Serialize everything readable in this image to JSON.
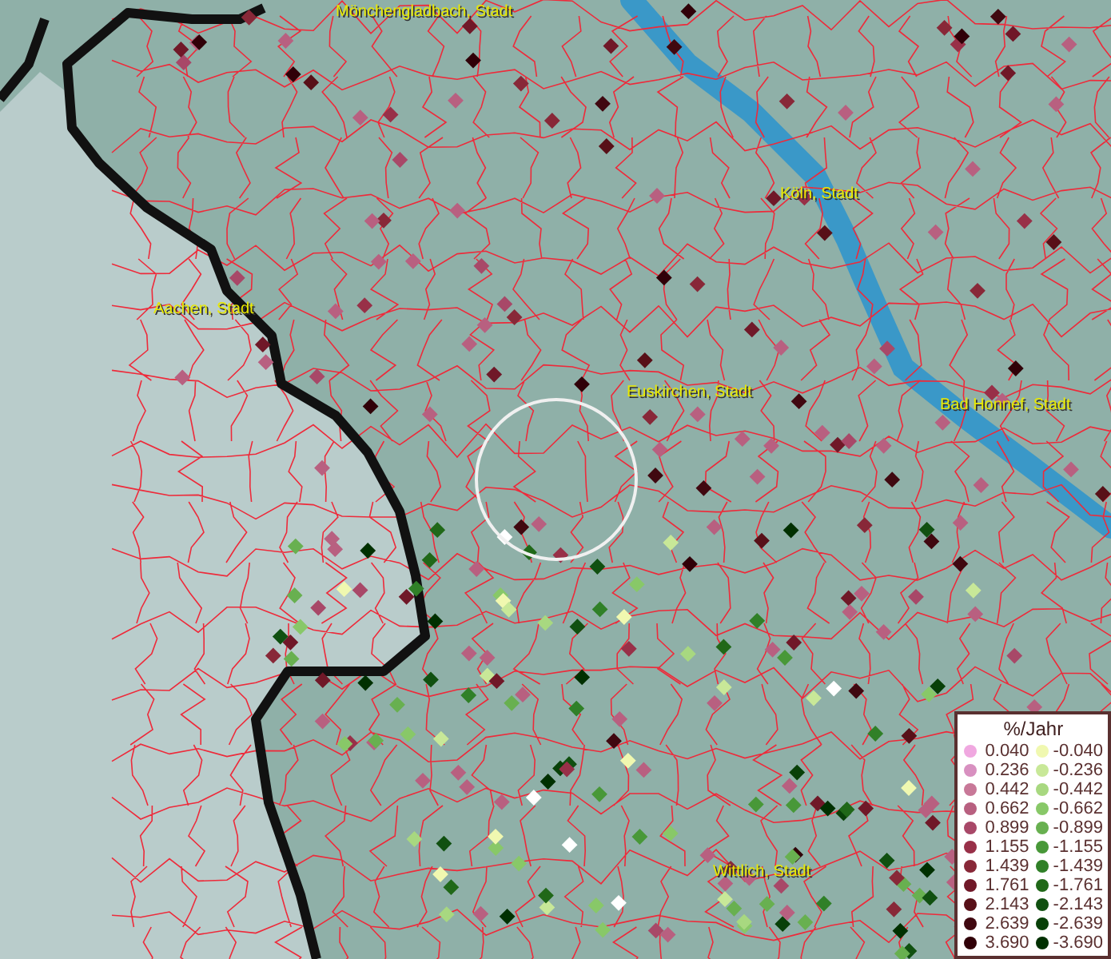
{
  "map": {
    "places": [
      {
        "name": "Mönchengladbach, Stadt"
      },
      {
        "name": "Köln, Stadt"
      },
      {
        "name": "Aachen, Stadt"
      },
      {
        "name": "Euskirchen, Stadt"
      },
      {
        "name": "Bad Honnef, Stadt"
      },
      {
        "name": "Wittlich, Stadt"
      }
    ]
  },
  "legend": {
    "title": "%/Jahr",
    "rows": [
      {
        "positive": {
          "value": "0.040",
          "color": "#f0a8e0"
        },
        "negative": {
          "value": "-0.040",
          "color": "#f0f8b0"
        }
      },
      {
        "positive": {
          "value": "0.236",
          "color": "#d890c0"
        },
        "negative": {
          "value": "-0.236",
          "color": "#c8e898"
        }
      },
      {
        "positive": {
          "value": "0.442",
          "color": "#c87898"
        },
        "negative": {
          "value": "-0.442",
          "color": "#a8d880"
        }
      },
      {
        "positive": {
          "value": "0.662",
          "color": "#b86080"
        },
        "negative": {
          "value": "-0.662",
          "color": "#88c868"
        }
      },
      {
        "positive": {
          "value": "0.899",
          "color": "#a84868"
        },
        "negative": {
          "value": "-0.899",
          "color": "#68b050"
        }
      },
      {
        "positive": {
          "value": "1.155",
          "color": "#983048"
        },
        "negative": {
          "value": "-1.155",
          "color": "#489838"
        }
      },
      {
        "positive": {
          "value": "1.439",
          "color": "#882838"
        },
        "negative": {
          "value": "-1.439",
          "color": "#308028"
        }
      },
      {
        "positive": {
          "value": "1.761",
          "color": "#701828"
        },
        "negative": {
          "value": "-1.761",
          "color": "#206818"
        }
      },
      {
        "positive": {
          "value": "2.143",
          "color": "#581018"
        },
        "negative": {
          "value": "-2.143",
          "color": "#105010"
        }
      },
      {
        "positive": {
          "value": "2.639",
          "color": "#400810"
        },
        "negative": {
          "value": "-2.639",
          "color": "#084008"
        }
      },
      {
        "positive": {
          "value": "3.690",
          "color": "#300008"
        },
        "negative": {
          "value": "-3.690",
          "color": "#003000"
        }
      }
    ]
  }
}
